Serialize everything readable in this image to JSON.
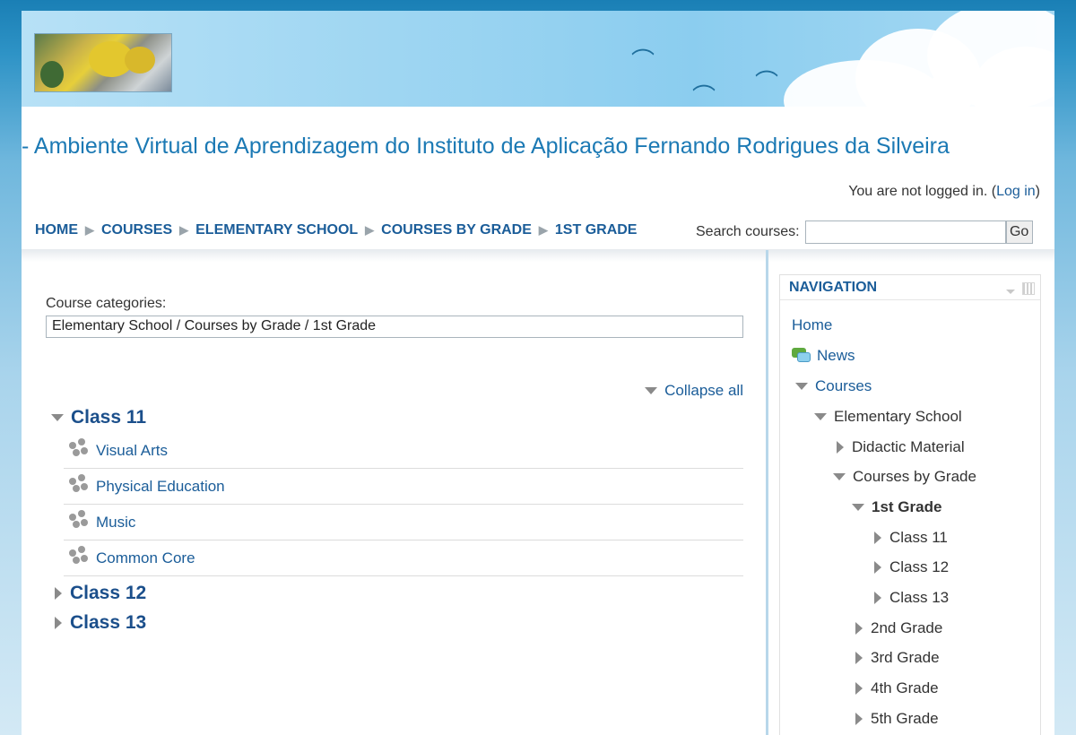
{
  "header": {
    "site_title": "- Ambiente Virtual de Aprendizagem do Instituto de Aplicação Fernando Rodrigues da Silveira",
    "login_text": "You are not logged in. (",
    "login_link": "Log in",
    "login_close": ")"
  },
  "breadcrumb": [
    "HOME",
    "COURSES",
    "ELEMENTARY SCHOOL",
    "COURSES BY GRADE",
    "1ST GRADE"
  ],
  "search": {
    "label": "Search courses:",
    "value": "",
    "button": "Go"
  },
  "main": {
    "categories_label": "Course categories:",
    "categories_value": "Elementary School / Courses by Grade / 1st Grade",
    "collapse_all": "Collapse all",
    "classes": [
      {
        "name": "Class 11",
        "expanded": true,
        "courses": [
          "Visual Arts",
          "Physical Education",
          "Music",
          "Common Core"
        ]
      },
      {
        "name": "Class 12",
        "expanded": false
      },
      {
        "name": "Class 13",
        "expanded": false
      }
    ]
  },
  "navigation": {
    "title": "NAVIGATION",
    "items": {
      "home": "Home",
      "news": "News",
      "courses": "Courses",
      "elementary_school": "Elementary School",
      "didactic_material": "Didactic Material",
      "courses_by_grade": "Courses by Grade",
      "first_grade": "1st Grade",
      "class_11": "Class 11",
      "class_12": "Class 12",
      "class_13": "Class 13",
      "second_grade": "2nd Grade",
      "third_grade": "3rd Grade",
      "fourth_grade": "4th Grade",
      "fifth_grade": "5th Grade"
    }
  },
  "colors": {
    "link": "#1b5d99",
    "title": "#1b79b4",
    "class_heading": "#1b4f8b"
  }
}
